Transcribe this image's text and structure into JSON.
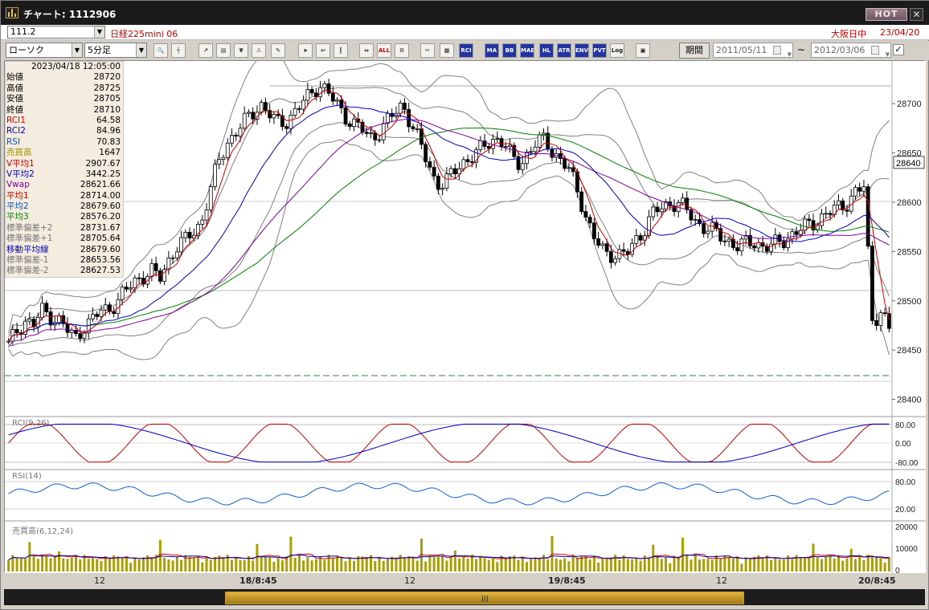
{
  "window": {
    "title": "チャート: 1112906",
    "hot_label": "HOT",
    "close_label": "✕"
  },
  "header": {
    "code": "111.2",
    "instrument": "日経225mini 06",
    "market": "大阪日中",
    "date": "23/04/20"
  },
  "toolbar": {
    "chart_type": "ローソク",
    "interval": "5分足",
    "buttons": [
      "zoom-icon",
      "crosshair-icon",
      "trend-icon",
      "bar-compare-icon",
      "dollar-icon",
      "warning-icon",
      "pencil-icon",
      "cursor-icon",
      "arrow-icon",
      "candle-icon",
      "move-icon",
      "ALL",
      "settings-icon",
      "tools-icon",
      "palette-icon",
      "RCI",
      "MA",
      "BB",
      "MAE",
      "HL",
      "ATR",
      "ENV",
      "PVT",
      "Log",
      "sub-icon"
    ],
    "period_label": "期間",
    "date_from": "2011/05/11",
    "date_to": "2012/03/06",
    "range_sep": "~"
  },
  "info_panel": {
    "datetime": "2023/04/18  12:05:00",
    "rows": [
      {
        "k": "始値",
        "v": "28720",
        "color": "#000000"
      },
      {
        "k": "高値",
        "v": "28725",
        "color": "#000000"
      },
      {
        "k": "安値",
        "v": "28705",
        "color": "#000000"
      },
      {
        "k": "終値",
        "v": "28710",
        "color": "#000000"
      },
      {
        "k": "RCI1",
        "v": "64.58",
        "color": "#d00000"
      },
      {
        "k": "RCI2",
        "v": "84.96",
        "color": "#0000c0"
      },
      {
        "k": "RSI",
        "v": "70.83",
        "color": "#0055cc"
      },
      {
        "k": "売買高",
        "v": "1647",
        "color": "#a09000"
      },
      {
        "k": "V平均1",
        "v": "2907.67",
        "color": "#d00000"
      },
      {
        "k": "V平均2",
        "v": "3442.25",
        "color": "#0000c0"
      },
      {
        "k": "Vwap",
        "v": "28621.66",
        "color": "#7a00a0"
      },
      {
        "k": "平均1",
        "v": "28714.00",
        "color": "#d00000"
      },
      {
        "k": "平均2",
        "v": "28679.60",
        "color": "#0055cc"
      },
      {
        "k": "平均3",
        "v": "28576.20",
        "color": "#008000"
      },
      {
        "k": "標準偏差+2",
        "v": "28731.67",
        "color": "#777777"
      },
      {
        "k": "標準偏差+1",
        "v": "28705.64",
        "color": "#777777"
      },
      {
        "k": "移動平均線",
        "v": "28679.60",
        "color": "#0000c0"
      },
      {
        "k": "標準偏差-1",
        "v": "28653.56",
        "color": "#777777"
      },
      {
        "k": "標準偏差-2",
        "v": "28627.53",
        "color": "#777777"
      }
    ]
  },
  "panels": {
    "rci_label": "RCI(9,26)",
    "rsi_label": "RSI(14)",
    "vol_label": "売買高(6,12,24)",
    "rci_ticks": [
      "80.00",
      "0.00",
      "-80.00"
    ],
    "rsi_ticks": [
      "80.00",
      "20.00"
    ],
    "vol_ticks": [
      "20000",
      "10000",
      "0"
    ]
  },
  "chart_data": {
    "type": "candlestick",
    "price_ticks": [
      28700,
      28650,
      28600,
      28550,
      28500,
      28450,
      28400
    ],
    "ylim": [
      28385,
      28740
    ],
    "current_price": "28640",
    "x_labels": [
      {
        "t": "12",
        "bold": false
      },
      {
        "t": "18/8:45",
        "bold": true
      },
      {
        "t": "12",
        "bold": false
      },
      {
        "t": "19/8:45",
        "bold": true
      },
      {
        "t": "12",
        "bold": false
      },
      {
        "t": "20/8:45",
        "bold": true
      }
    ],
    "close_path": [
      28455,
      28470,
      28480,
      28475,
      28490,
      28485,
      28480,
      28470,
      28462,
      28475,
      28480,
      28490,
      28492,
      28500,
      28510,
      28520,
      28525,
      28530,
      28522,
      28540,
      28555,
      28560,
      28570,
      28580,
      28610,
      28640,
      28660,
      28670,
      28680,
      28690,
      28700,
      28690,
      28680,
      28682,
      28690,
      28700,
      28710,
      28720,
      28712,
      28700,
      28690,
      28680,
      28675,
      28665,
      28670,
      28680,
      28690,
      28700,
      28680,
      28660,
      28640,
      28620,
      28618,
      28630,
      28640,
      28645,
      28650,
      28660,
      28665,
      28660,
      28645,
      28640,
      28650,
      28660,
      28665,
      28650,
      28640,
      28630,
      28610,
      28580,
      28560,
      28550,
      28548,
      28545,
      28550,
      28565,
      28575,
      28590,
      28595,
      28600,
      28598,
      28590,
      28580,
      28575,
      28570,
      28565,
      28560,
      28555,
      28558,
      28560,
      28555,
      28555,
      28560,
      28565,
      28570,
      28575,
      28580,
      28585,
      28590,
      28595,
      28600,
      28610,
      28615,
      28480,
      28490,
      28470
    ]
  },
  "colors": {
    "candle": "#000000",
    "ma1": "#d00000",
    "ma2": "#0000c0",
    "ma3": "#008000",
    "vwap": "#8000a0",
    "band": "#808080",
    "rci1": "#d00000",
    "rci2": "#0000c0",
    "rsi": "#1060d0",
    "volume": "#a8a000"
  }
}
